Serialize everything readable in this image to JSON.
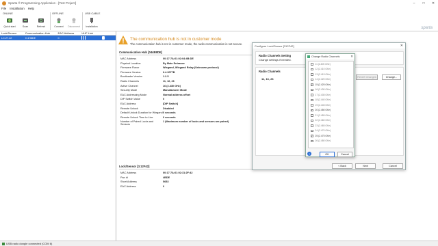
{
  "window": {
    "title": "Sparta ® Programming Application - [Test Project]"
  },
  "menu": [
    "File",
    "Installation",
    "Help"
  ],
  "ribbon": {
    "groups": [
      {
        "label": "ONLINE"
      },
      {
        "label": "OFFLINE"
      },
      {
        "label": "USB CABLE"
      }
    ],
    "buttons": [
      {
        "label": "Quick start",
        "icon": "rocket-icon",
        "disabled": false
      },
      {
        "label": "Scan",
        "icon": "scan-icon",
        "disabled": false
      },
      {
        "label": "Refresh",
        "icon": "refresh-icon",
        "disabled": false
      },
      {
        "label": "Connect",
        "icon": "connect-icon",
        "disabled": false
      },
      {
        "label": "Disconnect",
        "icon": "disconnect-icon",
        "disabled": true
      },
      {
        "label": "Installation",
        "icon": "usb-icon",
        "disabled": false
      }
    ],
    "brand": "sparta"
  },
  "left_table": {
    "headers": [
      "Lock/Sensor",
      "Communication Hub",
      "EAC Address",
      "UHF Link",
      ""
    ],
    "rows": [
      {
        "cells": [
          "LC.27.42",
          "0 4H8DE",
          "0",
          "",
          ""
        ],
        "selected": true
      }
    ]
  },
  "warning": {
    "title": "The communication hub is not in customer mode",
    "subtitle": "The communication hub is not in customer mode, the radio communication is not secure."
  },
  "hub": {
    "heading": "Communication Hub [044B8DE]",
    "rows": [
      {
        "k": "MAC Address",
        "v": "00:17:7A:01:02:04:4B:DE"
      },
      {
        "k": "Physical Location",
        "v": "By Main Entrance"
      },
      {
        "k": "Firmware Flavor",
        "v": "Wiegand, Wiegand Relay (Unknown protocol)"
      },
      {
        "k": "Firmware Version",
        "v": "6.4.3077B"
      },
      {
        "k": "Bootloader Version",
        "v": "1.2.5"
      },
      {
        "k": "Radio Channels",
        "v": "11, 16, 26"
      },
      {
        "k": "Active Channel",
        "v": "16 (2.430 GHz)"
      },
      {
        "k": "Security Mode",
        "v": "Manufacturer Mode"
      },
      {
        "k": "EAC Addressing Mode",
        "v": "Normal address offset"
      },
      {
        "k": "DIP Switch Value",
        "v": "0"
      },
      {
        "k": "EAC Address",
        "v": "[DIP Switch]"
      },
      {
        "k": "Remote Unlock",
        "v": "Disabled"
      },
      {
        "k": "Default Unlock Duration for Wiegand",
        "v": "0 seconds"
      },
      {
        "k": "Remote Unlock Time to Live",
        "v": "0 seconds"
      },
      {
        "k": "Number of Paired Locks and Sensors",
        "v": "1 (Maximum number of locks and sensors are paired)"
      }
    ]
  },
  "lock": {
    "heading": "Lock/Sensor [3.12F42]",
    "rows": [
      {
        "k": "MAC Address",
        "v": "00:17:7A:01:02:31:2F:42"
      },
      {
        "k": "Pan id",
        "v": "4BDE"
      },
      {
        "k": "Short Address",
        "v": "5683"
      },
      {
        "k": "EAC Address",
        "v": "0"
      }
    ]
  },
  "wizard": {
    "title": "Configure Lock/Sensor [312F42]",
    "header_title": "Radio Channels Setting",
    "header_sub": "Change settings if needed.",
    "section": "Radio Channels",
    "value": "11, 16, 26",
    "revert_label": "Revert Changes",
    "change_label": "Change...",
    "back_label": "< Back",
    "next_label": "Next",
    "cancel_label": "Cancel"
  },
  "channels_dialog": {
    "title": "Change Radio Channels",
    "ok_label": "OK",
    "cancel_label": "Cancel",
    "items": [
      {
        "label": "11 (2.405 GHz)",
        "checked": false
      },
      {
        "label": "12 (2.410 GHz)",
        "checked": false
      },
      {
        "label": "13 (2.415 GHz)",
        "checked": false
      },
      {
        "label": "14 (2.420 GHz)",
        "checked": false
      },
      {
        "label": "15 (2.425 GHz)",
        "checked": true
      },
      {
        "label": "16 (2.430 GHz)",
        "checked": false
      },
      {
        "label": "17 (2.435 GHz)",
        "checked": false
      },
      {
        "label": "18 (2.440 GHz)",
        "checked": false
      },
      {
        "label": "19 (2.445 GHz)",
        "checked": false
      },
      {
        "label": "20 (2.450 GHz)",
        "checked": true
      },
      {
        "label": "21 (2.455 GHz)",
        "checked": false
      },
      {
        "label": "22 (2.460 GHz)",
        "checked": false
      },
      {
        "label": "23 (2.465 GHz)",
        "checked": false
      },
      {
        "label": "24 (2.470 GHz)",
        "checked": false
      },
      {
        "label": "25 (2.475 GHz)",
        "checked": true
      },
      {
        "label": "26 (2.480 GHz)",
        "checked": false
      }
    ]
  },
  "status": {
    "text": "USB radio dongle connected (COM 6)"
  }
}
